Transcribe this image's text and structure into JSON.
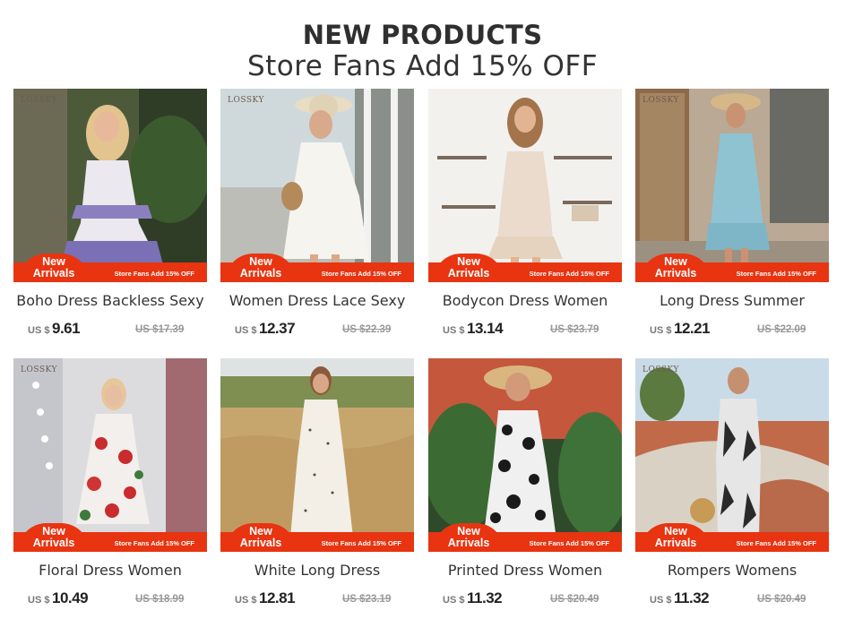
{
  "header": {
    "title": "NEW PRODUCTS",
    "subtitle": "Store Fans Add 15% OFF"
  },
  "badge": {
    "text": "New\nArrivals",
    "banner_text": "Store Fans Add 15% OFF",
    "brand_mark": "LOSSKY"
  },
  "colors": {
    "accent_red": "#e83411"
  },
  "products": [
    {
      "title": "Boho Dress Backless Sexy",
      "currency": "US $",
      "price": "9.61",
      "old_price": "US $17.39"
    },
    {
      "title": "Women Dress Lace Sexy",
      "currency": "US $",
      "price": "12.37",
      "old_price": "US $22.39"
    },
    {
      "title": "Bodycon Dress Women",
      "currency": "US $",
      "price": "13.14",
      "old_price": "US $23.79"
    },
    {
      "title": "Long Dress Summer",
      "currency": "US $",
      "price": "12.21",
      "old_price": "US $22.09"
    },
    {
      "title": "Floral Dress Women",
      "currency": "US $",
      "price": "10.49",
      "old_price": "US $18.99"
    },
    {
      "title": "White Long Dress",
      "currency": "US $",
      "price": "12.81",
      "old_price": "US $23.19"
    },
    {
      "title": "Printed Dress Women",
      "currency": "US $",
      "price": "11.32",
      "old_price": "US $20.49"
    },
    {
      "title": "Rompers Womens",
      "currency": "US $",
      "price": "11.32",
      "old_price": "US $20.49"
    }
  ]
}
